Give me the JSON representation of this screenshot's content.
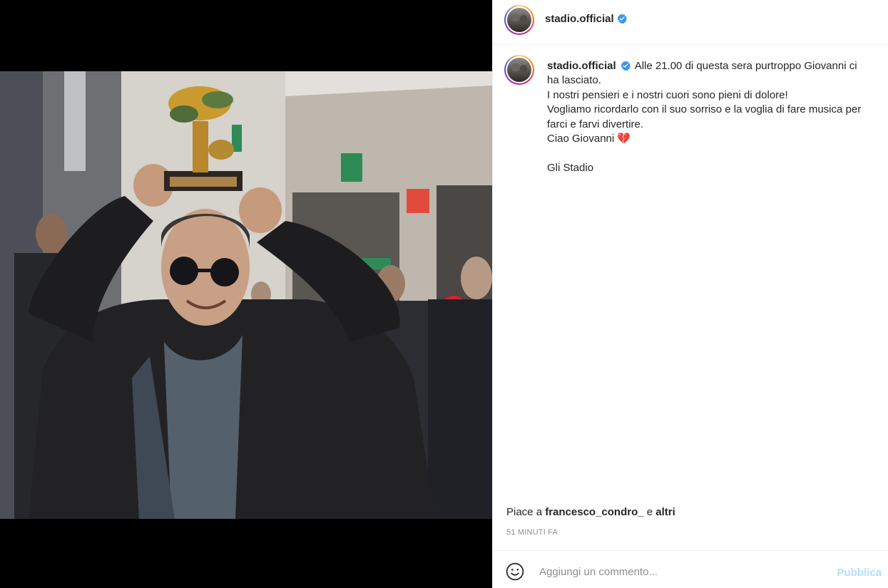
{
  "post": {
    "username": "stadio.official",
    "verified": true,
    "caption_lines": [
      "Alle 21.00 di questa sera purtroppo Giovanni ci ha lasciato.",
      "I nostri pensieri e i nostri cuori sono pieni di dolore!",
      "Vogliamo ricordarlo con il suo sorriso e la voglia di fare musica per farci e farvi divertire.",
      "Ciao Giovanni 💔",
      "",
      "Gli Stadio"
    ],
    "caption_first": "Alle 21.00 di questa sera purtroppo Giovanni ci ha lasciato.\nI nostri pensieri e i nostri cuori sono pieni di dolore!\nVogliamo ricordarlo con il suo sorriso e la voglia di fare musica per farci e farvi divertire.\nCiao Giovanni 💔\n\nGli Stadio"
  },
  "likes": {
    "prefix": "Piace a",
    "user": "francesco_condro_",
    "conj": "e",
    "others": "altri"
  },
  "timestamp": "51 minuti fa",
  "comment": {
    "placeholder": "Aggiungi un commento...",
    "publish_label": "Pubblica"
  },
  "colors": {
    "verified": "#3897f0",
    "publish_disabled": "#b2dffc",
    "meta_text": "#8e8e8e"
  },
  "icons": [
    "verified-badge-icon",
    "emoji-icon"
  ]
}
